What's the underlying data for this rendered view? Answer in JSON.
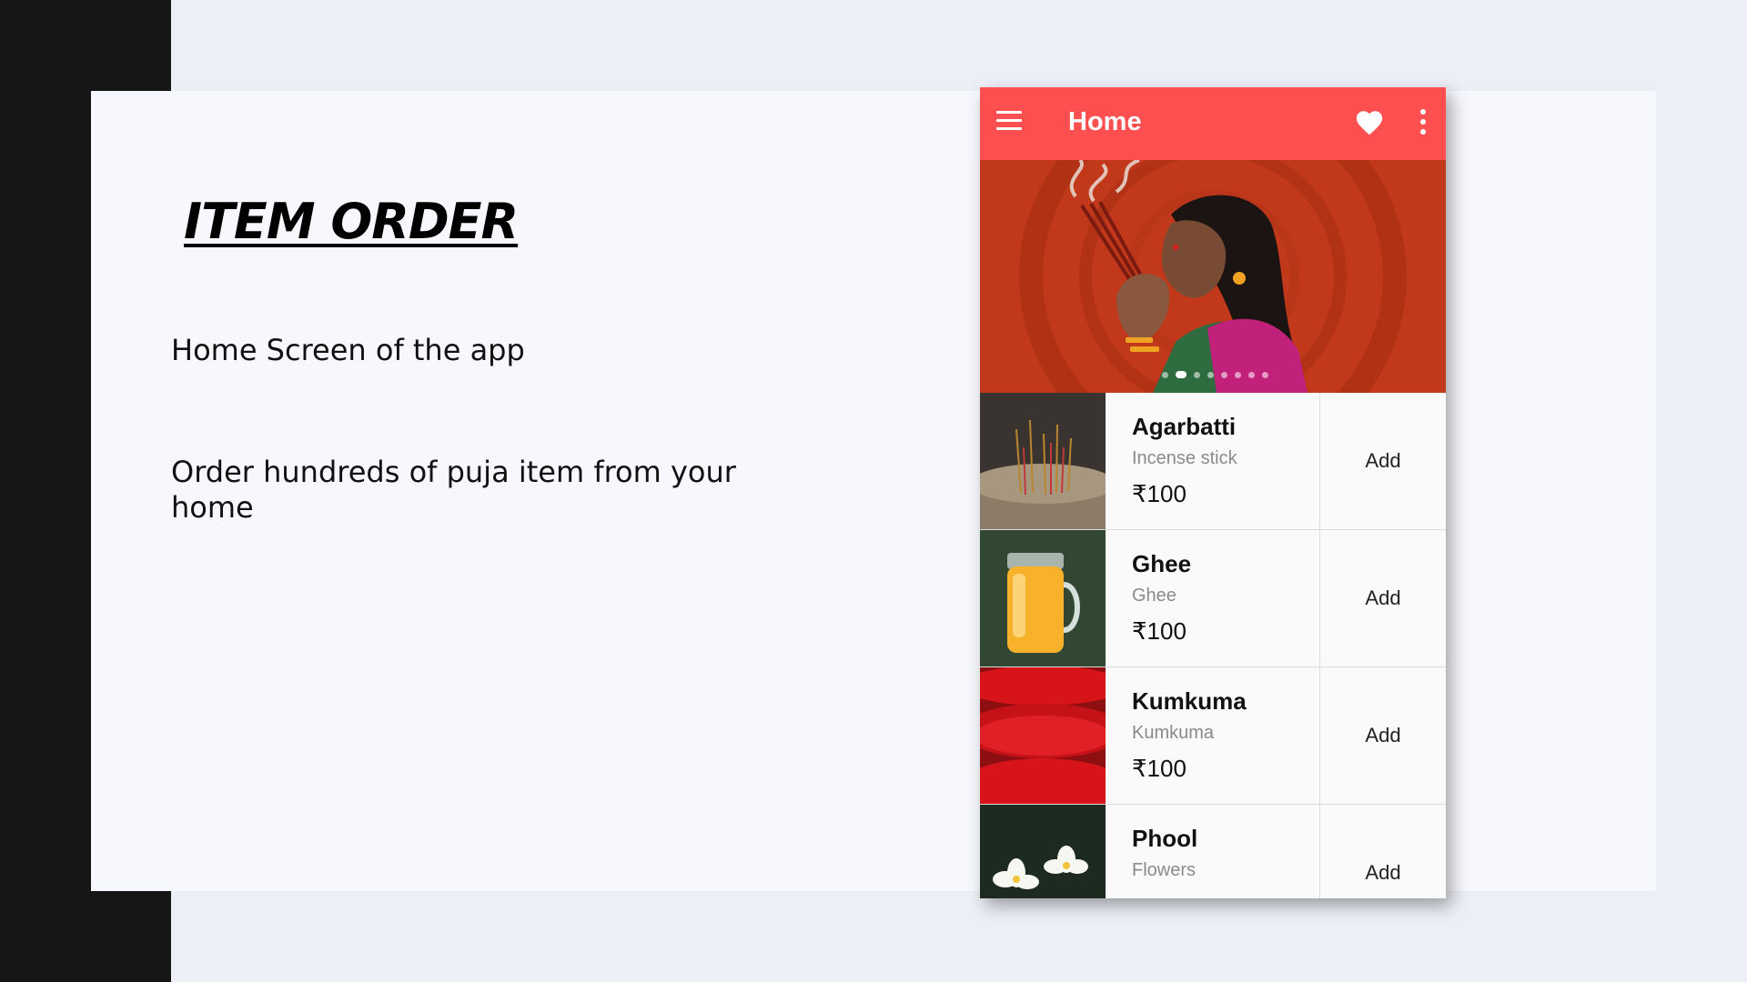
{
  "slide": {
    "title": "ITEM ORDER",
    "paragraph1": "Home Screen of the app",
    "paragraph2": "Order hundreds of puja item from your home"
  },
  "app": {
    "title": "Home",
    "accent_color": "#fd4f4f",
    "icons": [
      "menu-icon",
      "heart-icon",
      "more-vert-icon"
    ],
    "carousel": {
      "dot_count": 8,
      "active_index": 1
    },
    "items": [
      {
        "name": "Agarbatti",
        "subtitle": "Incense stick",
        "price": "₹100",
        "action": "Add"
      },
      {
        "name": "Ghee",
        "subtitle": "Ghee",
        "price": "₹100",
        "action": "Add"
      },
      {
        "name": "Kumkuma",
        "subtitle": "Kumkuma",
        "price": "₹100",
        "action": "Add"
      },
      {
        "name": "Phool",
        "subtitle": "Flowers",
        "price": "",
        "action": "Add"
      }
    ]
  }
}
